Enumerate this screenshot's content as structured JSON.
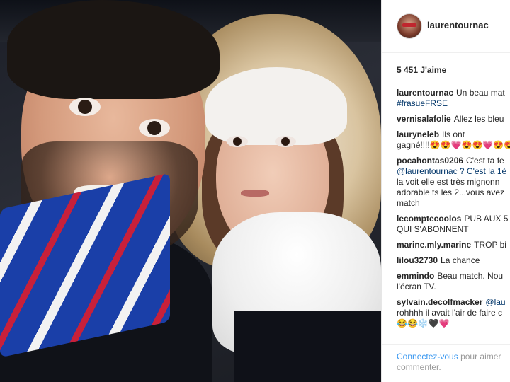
{
  "post": {
    "username": "laurentournac",
    "likes": "5 451 J'aime"
  },
  "comments": [
    {
      "user": "laurentournac",
      "lines": [
        "Un beau mat",
        "#frasueFRSE"
      ]
    },
    {
      "user": "vernisalafolie",
      "lines": [
        "Allez les bleu"
      ]
    },
    {
      "user": "lauryneleb",
      "lines": [
        "Ils ont",
        "gagné!!!!😍😍💗😍😍💗😍😍"
      ]
    },
    {
      "user": "pocahontas0206",
      "lines": [
        "C'est ta fe",
        "@laurentournac ? C'est la 1è",
        "la voit elle est très mignonn",
        "adorable ts les 2...vous avez",
        "match"
      ]
    },
    {
      "user": "lecomptecoolos",
      "lines": [
        "PUB AUX 5",
        "QUI S'ABONNENT"
      ]
    },
    {
      "user": "marine.mly.marine",
      "lines": [
        "TROP bi"
      ]
    },
    {
      "user": "lilou32730",
      "lines": [
        "La chance"
      ]
    },
    {
      "user": "emmindo",
      "lines": [
        "Beau match. Nou",
        "l'écran TV."
      ]
    },
    {
      "user": "sylvain.decolfmacker",
      "lines": [
        "@lau",
        "rohhhh il avait l'air de faire c",
        "😂😂❄️🖤💗"
      ]
    }
  ],
  "footer": {
    "link": "Connectez-vous",
    "text": "pour aimer",
    "text2": "commenter."
  }
}
